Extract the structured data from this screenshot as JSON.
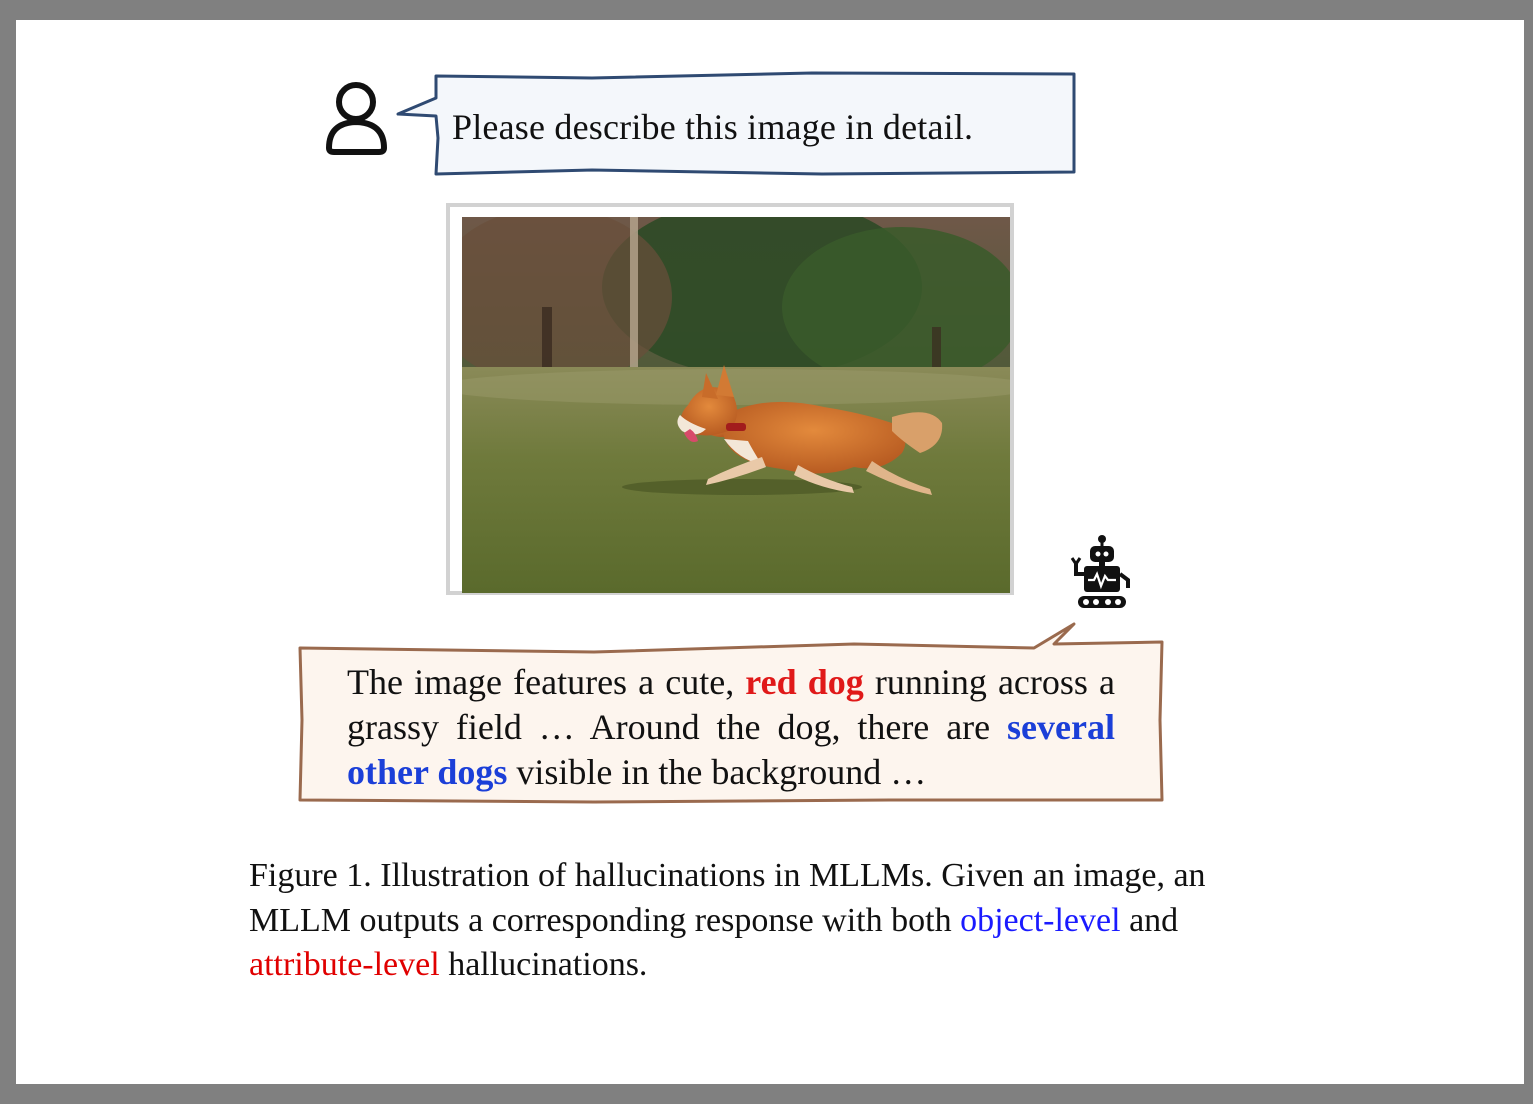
{
  "prompt": {
    "text": "Please describe this image in detail."
  },
  "response": {
    "part1": "The image features a cute, ",
    "highlight_attribute": "red dog",
    "part2": " running across a grassy field … Around the dog, there are ",
    "highlight_object": "several other dogs",
    "part3": " visible in the background …"
  },
  "caption": {
    "part1": "Figure 1. Illustration of hallucinations in MLLMs. Given an image, an MLLM outputs a corresponding response with both ",
    "object_level": "object-level",
    "part2": " and ",
    "attribute_level": "attribute-level",
    "part3": " hallucinations."
  },
  "icons": {
    "user": "user-icon",
    "robot": "robot-icon"
  },
  "colors": {
    "attribute_highlight": "#e01919",
    "object_highlight": "#1b3fd8",
    "caption_object": "#1a1aff",
    "caption_attribute": "#e00000",
    "prompt_bubble_fill": "#f4f7fb",
    "prompt_bubble_stroke": "#2f4a72",
    "response_bubble_fill": "#fdf5ee",
    "response_bubble_stroke": "#9a6a4e"
  }
}
